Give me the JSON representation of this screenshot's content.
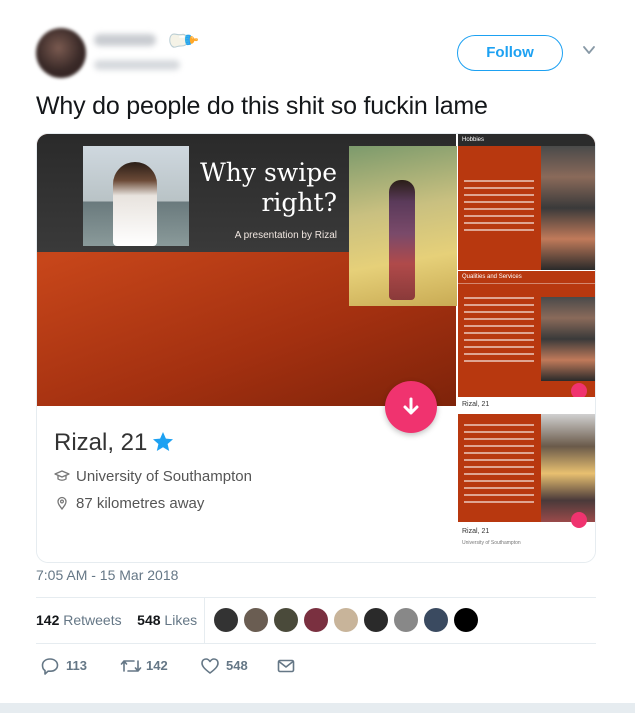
{
  "author": {
    "display_name": "ellie",
    "handle": "@linda",
    "emoji_icon": "baby-bottle-icon"
  },
  "header": {
    "follow_label": "Follow"
  },
  "tweet": {
    "text": "Why do people do this shit so fuckin lame"
  },
  "media": {
    "slide_title": "Why swipe right?",
    "slide_subtitle": "A presentation by Rizal",
    "profile_name": "Rizal, 21",
    "university": "University of Southampton",
    "distance": "87 kilometres away",
    "thumb_1_heading": "Hobbies",
    "thumb_2_heading": "Qualities and Services",
    "thumb_name": "Rizal, 21",
    "thumb_3_name": "Rizal, 21",
    "thumb_3_sub": "University of Southampton",
    "colors": {
      "slide_orange": "#b8380f",
      "tinder_pink": "#f0336f",
      "verified_blue": "#1da1f2"
    }
  },
  "meta": {
    "timestamp": "7:05 AM - 15 Mar 2018",
    "retweets_count": "142",
    "retweets_label": "Retweets",
    "likes_count": "548",
    "likes_label": "Likes"
  },
  "actions": {
    "reply_count": "113",
    "retweet_count": "142",
    "like_count": "548"
  }
}
